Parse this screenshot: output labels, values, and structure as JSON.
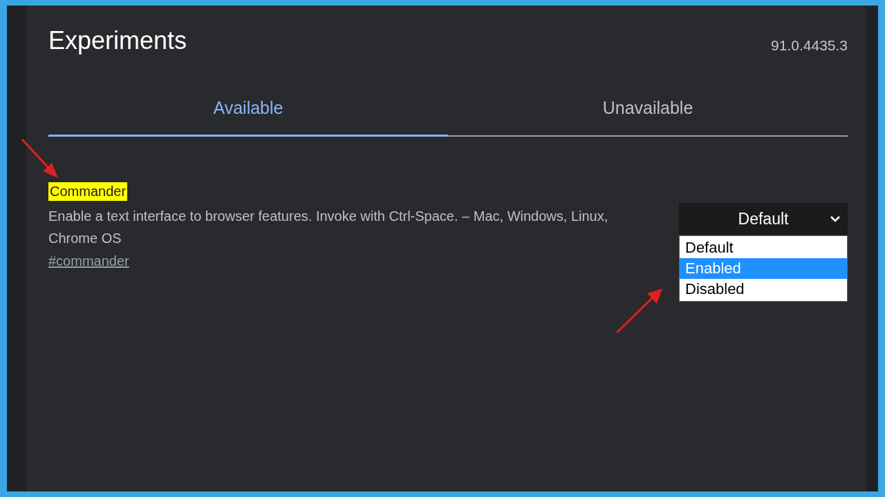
{
  "header": {
    "title": "Experiments",
    "version": "91.0.4435.3"
  },
  "tabs": [
    {
      "label": "Available",
      "selected": true
    },
    {
      "label": "Unavailable",
      "selected": false
    }
  ],
  "experiments": [
    {
      "name": "Commander",
      "highlighted": true,
      "description": "Enable a text interface to browser features. Invoke with Ctrl-Space. – Mac, Windows, Linux, Chrome OS",
      "link": "#commander",
      "select": {
        "value": "Default",
        "expanded": true,
        "options": [
          {
            "label": "Default",
            "highlighted": false
          },
          {
            "label": "Enabled",
            "highlighted": true
          },
          {
            "label": "Disabled",
            "highlighted": false
          }
        ]
      }
    }
  ]
}
